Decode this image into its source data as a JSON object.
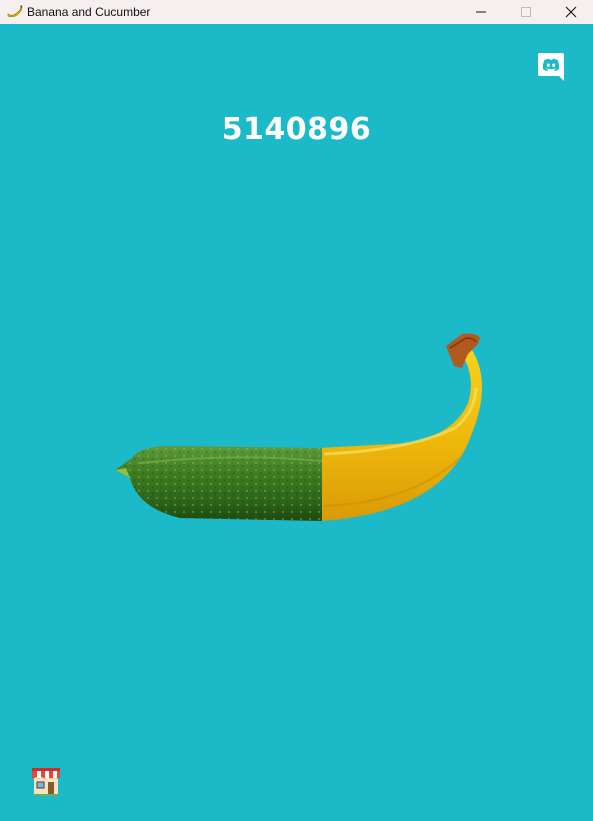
{
  "window": {
    "title": "Banana and Cucumber",
    "app_icon": "banana-icon",
    "controls": [
      "minimize-icon",
      "maximize-icon",
      "close-icon"
    ]
  },
  "game": {
    "score": "5140896",
    "clickable_object": "banana-cucumber",
    "background_color": "#1cb9c9"
  },
  "buttons": {
    "discord_icon": "discord-icon",
    "shop_icon": "shop-icon"
  }
}
